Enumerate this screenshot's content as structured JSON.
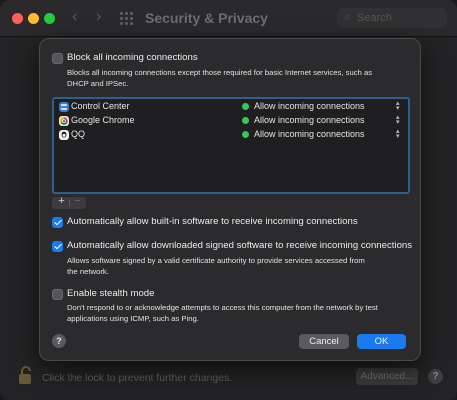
{
  "window": {
    "title": "Security & Privacy",
    "search_placeholder": "Search"
  },
  "bottom": {
    "lock_text": "Click the lock to prevent further changes.",
    "advanced_label": "Advanced...",
    "help_label": "?"
  },
  "dialog": {
    "block_all": {
      "label": "Block all incoming connections",
      "checked": false,
      "desc_line1": "Blocks all incoming connections except those required for basic Internet services, such as",
      "desc_line2": "DHCP and IPSec."
    },
    "apps": [
      {
        "name": "Control Center",
        "status": "Allow incoming connections",
        "icon": "control-center-icon",
        "icon_color": "#3a7bd5"
      },
      {
        "name": "Google Chrome",
        "status": "Allow incoming connections",
        "icon": "chrome-icon",
        "icon_color": "#e8e8e8"
      },
      {
        "name": "QQ",
        "status": "Allow incoming connections",
        "icon": "qq-icon",
        "icon_color": "#f4f4f4"
      }
    ],
    "add_label": "+",
    "remove_label": "−",
    "auto_builtin": {
      "label": "Automatically allow built-in software to receive incoming connections",
      "checked": true
    },
    "auto_signed": {
      "label": "Automatically allow downloaded signed software to receive incoming connections",
      "checked": true,
      "desc_line1": "Allows software signed by a valid certificate authority to provide services accessed from",
      "desc_line2": "the network."
    },
    "stealth": {
      "label": "Enable stealth mode",
      "checked": false,
      "desc_line1": "Don't respond to or acknowledge attempts to access this computer from the network by test",
      "desc_line2": "applications using ICMP, such as Ping."
    },
    "help_label": "?",
    "cancel_label": "Cancel",
    "ok_label": "OK"
  },
  "colors": {
    "accent": "#1a7bf0",
    "status_green": "#34c759"
  }
}
